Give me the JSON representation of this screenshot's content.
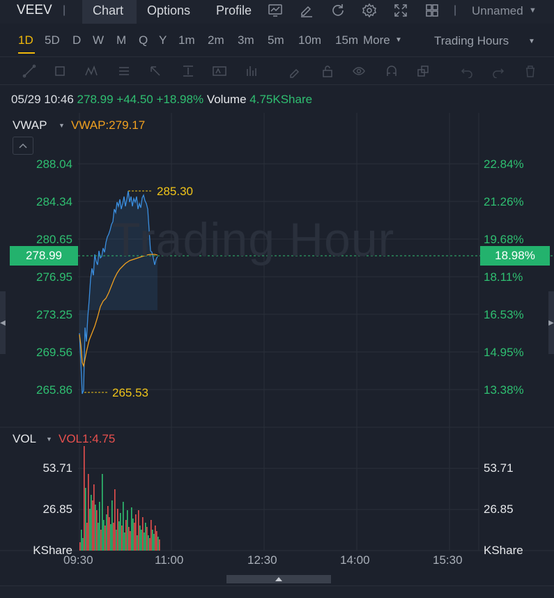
{
  "header": {
    "ticker": "VEEV",
    "tabs": [
      "Chart",
      "Options",
      "Profile"
    ],
    "layout_name": "Unnamed",
    "icons": [
      "monitor-chart-icon",
      "edit-pen-icon",
      "refresh-icon",
      "settings-gear-icon",
      "fullscreen-icon",
      "grid-layout-icon"
    ]
  },
  "timeframes": {
    "items": [
      "1D",
      "5D",
      "D",
      "W",
      "M",
      "Q",
      "Y",
      "1m",
      "2m",
      "3m",
      "5m",
      "10m",
      "15m"
    ],
    "active": "1D",
    "more_label": "More",
    "hours_label": "Trading Hours"
  },
  "quote": {
    "datetime": "05/29 10:46",
    "price": "278.99",
    "change": "+44.50",
    "change_pct": "+18.98%",
    "volume_label": "Volume",
    "volume_value": "4.75KShare"
  },
  "main_panel": {
    "indicator": "VWAP",
    "indicator_value": "VWAP:279.17",
    "watermark": "Trading Hour",
    "left_axis": [
      "288.04",
      "284.34",
      "280.65",
      "276.95",
      "273.25",
      "269.56",
      "265.86"
    ],
    "right_axis": [
      "22.84%",
      "21.26%",
      "19.68%",
      "18.11%",
      "16.53%",
      "14.95%",
      "13.38%"
    ],
    "current_price": "278.99",
    "current_pct": "18.98%",
    "high_label": "285.30",
    "low_label": "265.53"
  },
  "volume_panel": {
    "indicator": "VOL",
    "indicator_value": "VOL1:4.75",
    "left_axis": [
      "53.71",
      "26.85",
      "KShare"
    ],
    "right_axis": [
      "53.71",
      "26.85",
      "KShare"
    ]
  },
  "time_axis": [
    "09:30",
    "11:00",
    "12:30",
    "14:00",
    "15:30"
  ],
  "colors": {
    "up": "#2fbf71",
    "down": "#e8504e",
    "price_line": "#3b8fe0",
    "vwap_line": "#f0a020",
    "accent": "#f0b90b"
  }
}
